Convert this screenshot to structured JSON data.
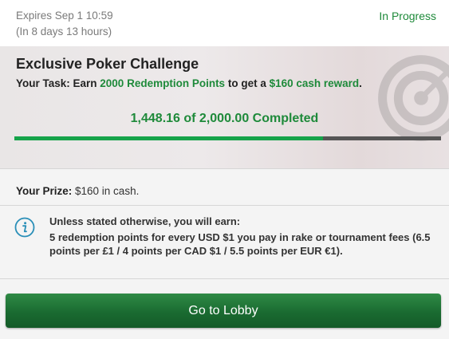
{
  "header": {
    "expires": "Expires Sep 1 10:59",
    "expires_relative": "(In 8 days 13 hours)",
    "status": "In Progress"
  },
  "challenge": {
    "title": "Exclusive Poker Challenge",
    "task_prefix": "Your Task: Earn ",
    "task_points": "2000 Redemption Points",
    "task_middle": " to get a ",
    "task_reward": "$160 cash reward",
    "task_suffix": ".",
    "completed_text": "1,448.16 of 2,000.00 Completed",
    "progress_fraction": 0.724
  },
  "prize": {
    "label": "Your Prize:",
    "value": " $160 in cash."
  },
  "info": {
    "title": "Unless stated otherwise, you will earn:",
    "body": "5 redemption points for every USD $1 you pay in rake or tournament fees (6.5 points per £1 / 4 points per CAD $1 / 5.5 points per EUR €1)."
  },
  "actions": {
    "lobby_label": "Go to Lobby"
  },
  "colors": {
    "accent_green": "#1e8a3a",
    "progress_fill": "#16a34a",
    "progress_track": "#555555",
    "button_green": "#1a6b31"
  },
  "icons": {
    "info": "info-circle-icon",
    "target": "target-icon"
  }
}
